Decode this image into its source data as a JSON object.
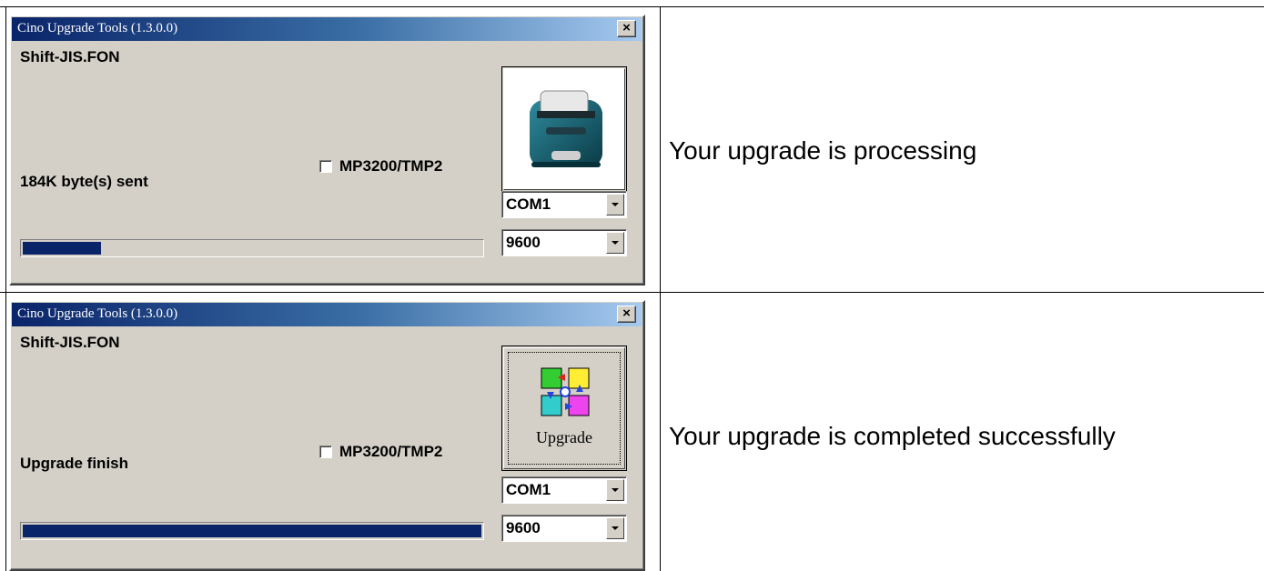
{
  "rows": [
    {
      "window": {
        "title": "Cino Upgrade Tools (1.3.0.0)",
        "close_glyph": "×",
        "filename": "Shift-JIS.FON",
        "checkbox_label": "MP3200/TMP2",
        "checkbox_checked": false,
        "status": "184K byte(s) sent",
        "progress_fraction": 0.17,
        "button_icon": "printer-icon",
        "button_label": "",
        "port": "COM1",
        "baud": "9600"
      },
      "caption": "Your upgrade is processing"
    },
    {
      "window": {
        "title": "Cino Upgrade Tools (1.3.0.0)",
        "close_glyph": "×",
        "filename": "Shift-JIS.FON",
        "checkbox_label": "MP3200/TMP2",
        "checkbox_checked": false,
        "status": "Upgrade finish",
        "progress_fraction": 1.0,
        "button_icon": "upgrade-icon",
        "button_label": "Upgrade",
        "port": "COM1",
        "baud": "9600"
      },
      "caption": "Your upgrade is completed successfully"
    }
  ],
  "colors": {
    "window_bg": "#d4d0c8",
    "titlebar_start": "#0a246a",
    "titlebar_end": "#a6caf0",
    "progress_fill": "#0a246a"
  }
}
